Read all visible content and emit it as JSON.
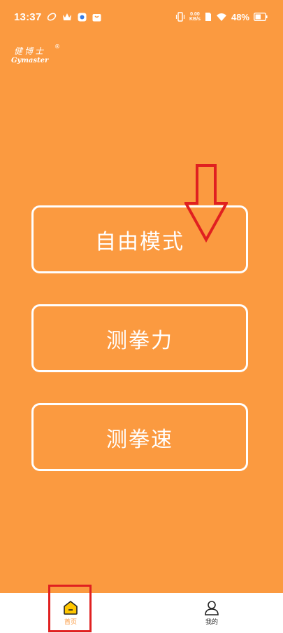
{
  "status_bar": {
    "time": "13:37",
    "speed_value": "0.00",
    "speed_unit": "KB/s",
    "battery_percent": "48%"
  },
  "logo": {
    "cn_text": "健博士",
    "en_text": "Gymaster",
    "reg_mark": "®"
  },
  "menu": {
    "free_mode": "自由模式",
    "punch_force": "测拳力",
    "punch_speed": "测拳速"
  },
  "tabs": [
    {
      "label": "首页",
      "icon": "home-icon",
      "active": true
    },
    {
      "label": "我的",
      "icon": "user-icon",
      "active": false
    }
  ],
  "colors": {
    "background": "#fb9a40",
    "annotation_red": "#e02020",
    "active_tab": "#ffc600"
  }
}
